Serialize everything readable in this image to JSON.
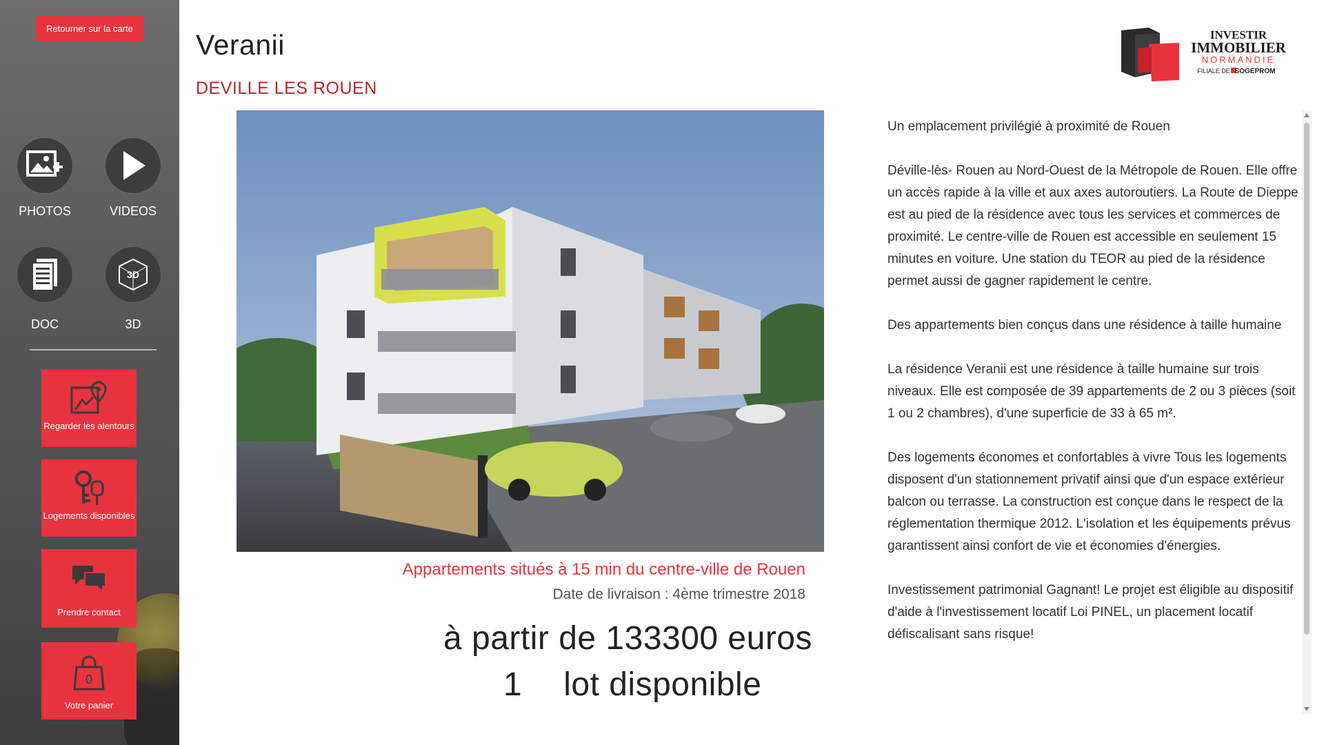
{
  "sidebar": {
    "back_label": "Retourner sur la carte",
    "media": [
      {
        "label": "PHOTOS",
        "icon": "add-photo-icon"
      },
      {
        "label": "VIDEOS",
        "icon": "play-icon"
      },
      {
        "label": "DOC",
        "icon": "document-icon"
      },
      {
        "label": "3D",
        "icon": "3d-cube-icon"
      }
    ],
    "tiles": [
      {
        "label": "Regarder les alentours",
        "icon": "map-pin-icon"
      },
      {
        "label": "Logements disponibles",
        "icon": "keys-icon"
      },
      {
        "label": "Prendre contact",
        "icon": "chat-icon"
      },
      {
        "label": "Votre panier",
        "icon": "basket-icon"
      }
    ]
  },
  "header": {
    "title": "Veranii",
    "city": "DEVILLE LES ROUEN"
  },
  "logo": {
    "line1": "INVESTIR",
    "line2": "IMMOBILIER",
    "line3": "NORMANDIE",
    "line4_prefix": "FILIALE DE",
    "line4_brand": "SOGEPROM"
  },
  "main": {
    "caption": "Appartements situés à 15 min du centre-ville de Rouen",
    "delivery": "Date de livraison : 4ème trimestre 2018",
    "price": "à partir de 133300 euros",
    "lots_count": "1",
    "lots_label": "lot disponible"
  },
  "description": {
    "paragraphs": [
      "Un emplacement privilégié à proximité de Rouen",
      "Déville-lès- Rouen au Nord-Ouest de la Métropole de Rouen. Elle offre un accès rapide à la ville et aux axes autoroutiers. La Route de Dieppe est au pied de la résidence avec tous les services et commerces de proximité. Le centre-ville de Rouen est accessible en seulement 15 minutes en voiture. Une station du TEOR au pied de la résidence permet aussi de gagner rapidement le centre.",
      "Des appartements bien conçus dans une résidence à taille humaine",
      "La résidence Veranii est une résidence à taille humaine sur trois niveaux. Elle est composée de 39 appartements de 2 ou 3 pièces (soit 1 ou 2 chambres), d'une superficie de 33 à 65 m².",
      "Des logements économes et confortables à vivre Tous les logements disposent d'un stationnement privatif ainsi que d'un espace extérieur balcon ou terrasse. La construction est conçue dans le respect de la réglementation thermique 2012. L'isolation et les équipements prévus garantissent ainsi confort de vie et économies d'énergies.",
      "Investissement patrimonial Gagnant! Le projet est éligible au dispositif d'aide à l'investissement locatif Loi PINEL, un placement locatif défiscalisant sans risque!"
    ]
  },
  "colors": {
    "accent": "#e8333f",
    "city": "#b5262d",
    "sidebar": "#5a5a5a"
  }
}
